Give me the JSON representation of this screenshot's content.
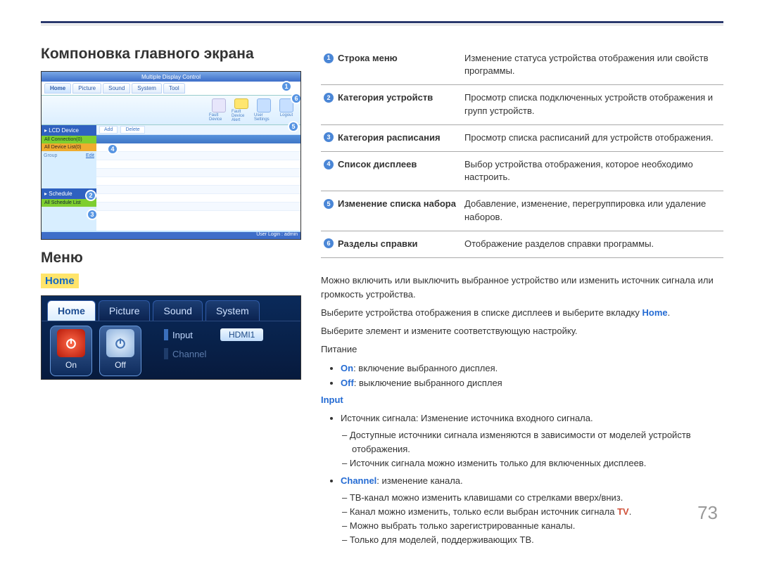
{
  "header": {
    "separator": true
  },
  "left": {
    "h1": "Компоновка главного экрана",
    "h2": "Меню",
    "home_label": "Home"
  },
  "shot1": {
    "title": "Multiple Display Control",
    "tabs": [
      "Home",
      "Picture",
      "Sound",
      "System",
      "Tool"
    ],
    "tools": [
      {
        "label": "Fault Device",
        "color": "#e8e7ff"
      },
      {
        "label": "Fault Device Alert",
        "color": "#ffe27a"
      },
      {
        "label": "User Settings",
        "color": "#c0dcff"
      },
      {
        "label": "Logout",
        "color": "#c0dcff"
      }
    ],
    "side_hdr1": "LCD Device",
    "side_sub1": "All Connection(0)",
    "side_sub2": "All Device List(0)",
    "side_group": "Group",
    "side_edit": "Edit",
    "side_hdr2": "Schedule",
    "side_sub3": "All Schedule List",
    "main_btns": [
      "Add",
      "Delete"
    ],
    "status": "User Login : admin",
    "bubbles": {
      "1": "1",
      "2": "2",
      "3": "3",
      "4": "4",
      "5": "5",
      "6": "6"
    }
  },
  "shot2": {
    "tabs": [
      "Home",
      "Picture",
      "Sound",
      "System"
    ],
    "on": "On",
    "off": "Off",
    "input_lbl": "Input",
    "input_val": "HDMI1",
    "channel_lbl": "Channel"
  },
  "legend": [
    {
      "n": "1",
      "label": "Строка меню",
      "desc": "Изменение статуса устройства отображения или свойств программы."
    },
    {
      "n": "2",
      "label": "Категория устройств",
      "desc": "Просмотр списка подключенных устройств отображения и групп устройств."
    },
    {
      "n": "3",
      "label": "Категория расписания",
      "desc": "Просмотр списка расписаний для устройств отображения."
    },
    {
      "n": "4",
      "label": "Список дисплеев",
      "desc": "Выбор устройства отображения, которое необходимо настроить."
    },
    {
      "n": "5",
      "label": "Изменение списка набора",
      "desc": "Добавление, изменение, перегруппировка или удаление наборов."
    },
    {
      "n": "6",
      "label": "Разделы справки",
      "desc": "Отображение разделов справки программы."
    }
  ],
  "body": {
    "p1": "Можно включить или выключить выбранное устройство или изменить источник сигнала или громкость устройства.",
    "p2_a": "Выберите устройства отображения в списке дисплеев и выберите вкладку ",
    "p2_b": "Home",
    "p2_c": ".",
    "p3": "Выберите элемент и измените соответствующую настройку.",
    "power_lbl": "Питание",
    "on_bold": "On",
    "on_text": ": включение выбранного дисплея.",
    "off_bold": "Off",
    "off_text": ": выключение выбранного дисплея",
    "input_hdr": "Input",
    "src_text": "Источник сигнала: Изменение источника входного сигнала.",
    "src_d1": "Доступные источники сигнала изменяются в зависимости от моделей устройств отображения.",
    "src_d2": "Источник сигнала можно изменить только для включенных дисплеев.",
    "ch_bold": "Channel",
    "ch_text": ": изменение канала.",
    "ch_d1": "ТВ-канал можно изменить клавишами со стрелками вверх/вниз.",
    "ch_d2_a": "Канал можно изменить, только если выбран источник сигнала ",
    "ch_d2_b": "TV",
    "ch_d2_c": ".",
    "ch_d3": "Можно выбрать только зарегистрированные каналы.",
    "ch_d4": "Только для моделей, поддерживающих ТВ."
  },
  "page_number": "73"
}
